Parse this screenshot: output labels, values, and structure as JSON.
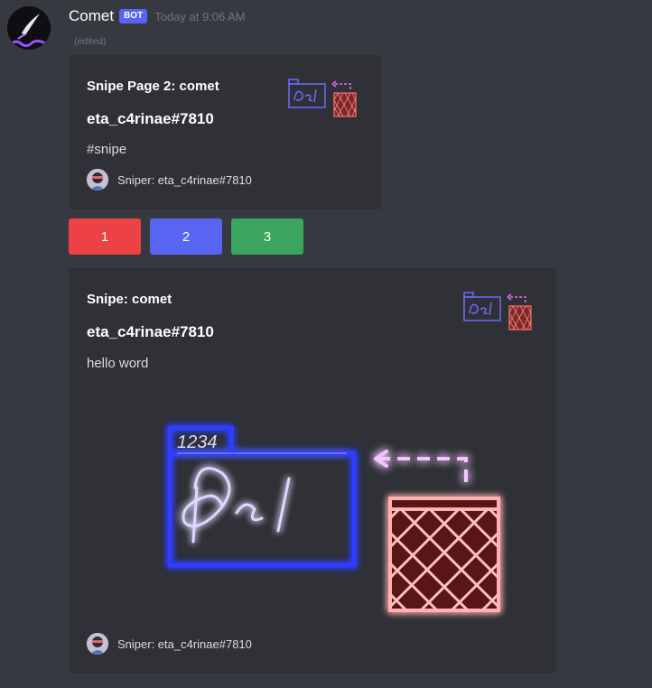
{
  "message": {
    "author": "Comet",
    "bot_badge": "BOT",
    "timestamp": "Today at 9:06 AM",
    "edited": "(edited)"
  },
  "embed1": {
    "title": "Snipe Page 2: comet",
    "author": "eta_c4rinae#7810",
    "description": "#snipe",
    "footer": "Sniper: eta_c4rinae#7810"
  },
  "buttons": [
    {
      "label": "1",
      "color": "#ed4245"
    },
    {
      "label": "2",
      "color": "#5865f2"
    },
    {
      "label": "3",
      "color": "#3ba55d"
    }
  ],
  "embed2": {
    "title": "Snipe: comet",
    "author": "eta_c4rinae#7810",
    "description": "hello word",
    "footer": "Sniper: eta_c4rinae#7810"
  },
  "image": {
    "folder_label": "1234",
    "sign_text": "Del"
  },
  "colors": {
    "background": "#36393f",
    "embed": "#2f3136",
    "accent_blue": "#5865f2",
    "neon_blue": "#4f6bff",
    "neon_red": "#ff6b6b",
    "neon_purple": "#d35cff"
  }
}
